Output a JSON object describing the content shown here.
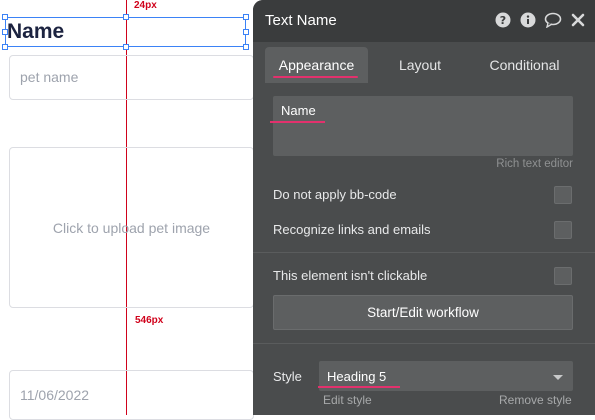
{
  "canvas": {
    "guide_top_label": "24px",
    "guide_mid_label": "546px",
    "title_text": "Name",
    "pet_name_placeholder": "pet name",
    "upload_text": "Click to upload pet image",
    "date_text": "11/06/2022"
  },
  "panel": {
    "title": "Text Name",
    "icons": [
      "help-icon",
      "info-icon",
      "comment-icon",
      "close-icon"
    ],
    "tabs": [
      {
        "label": "Appearance",
        "active": true
      },
      {
        "label": "Layout",
        "active": false
      },
      {
        "label": "Conditional",
        "active": false
      }
    ],
    "rich_text": {
      "value": "Name",
      "caption": "Rich text editor"
    },
    "options": {
      "bb_code": "Do not apply bb-code",
      "links": "Recognize links and emails",
      "not_clickable": "This element isn't clickable"
    },
    "workflow_button": "Start/Edit workflow",
    "style": {
      "label": "Style",
      "value": "Heading 5",
      "edit_link": "Edit style",
      "remove_link": "Remove style"
    },
    "colors": {
      "panel_bg": "#4a4c4d",
      "header_bg": "#3a3c3d",
      "accent_underline": "#e2316d",
      "guide_red": "#d0021b",
      "selection_blue": "#3b82f6"
    }
  }
}
